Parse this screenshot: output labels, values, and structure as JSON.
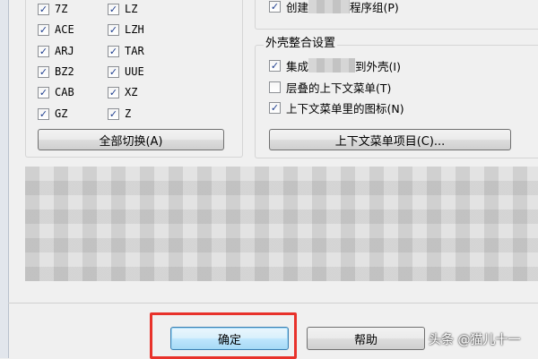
{
  "formats": {
    "left": [
      {
        "label": "7Z",
        "checked": true
      },
      {
        "label": "ACE",
        "checked": true
      },
      {
        "label": "ARJ",
        "checked": true
      },
      {
        "label": "BZ2",
        "checked": true
      },
      {
        "label": "CAB",
        "checked": true
      },
      {
        "label": "GZ",
        "checked": true
      }
    ],
    "right": [
      {
        "label": "LZ",
        "checked": true
      },
      {
        "label": "LZH",
        "checked": true
      },
      {
        "label": "TAR",
        "checked": true
      },
      {
        "label": "UUE",
        "checked": true
      },
      {
        "label": "XZ",
        "checked": true
      },
      {
        "label": "Z",
        "checked": true
      }
    ],
    "toggle_all_button": "全部切换(A)"
  },
  "options": {
    "create_group": {
      "label_start": "创建",
      "label_end": "程序组(P)",
      "checked": true
    }
  },
  "shell": {
    "legend": "外壳整合设置",
    "items": [
      {
        "label_start": "集成",
        "label_end": "到外壳(I)",
        "checked": true
      },
      {
        "label": "层叠的上下文菜单(T)",
        "checked": false
      },
      {
        "label": "上下文菜单里的图标(N)",
        "checked": true
      }
    ],
    "context_items_button": "上下文菜单项目(C)..."
  },
  "footer": {
    "ok_button": "确定",
    "help_button": "帮助"
  },
  "watermark": "头条 @猫儿十一",
  "colors": {
    "highlight": "#e8322b",
    "default_button_border": "#3c7fb1"
  }
}
